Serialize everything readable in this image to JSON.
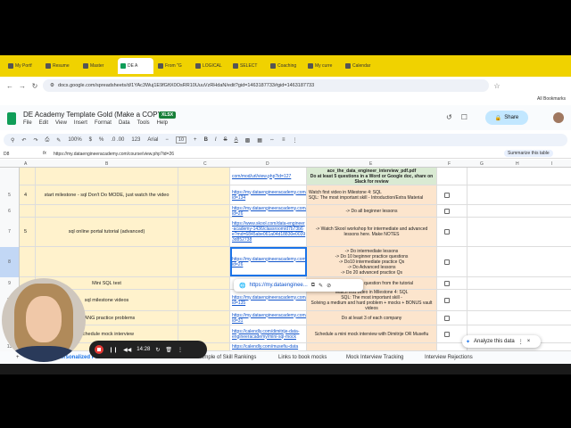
{
  "browser": {
    "tabs": [
      {
        "label": "My Portf"
      },
      {
        "label": "Resume"
      },
      {
        "label": "Master"
      },
      {
        "label": "DE A",
        "active": true
      },
      {
        "label": "From \"G"
      },
      {
        "label": "LOGICAL"
      },
      {
        "label": "SELECT"
      },
      {
        "label": "Coaching"
      },
      {
        "label": "My curre"
      },
      {
        "label": "Calendar"
      }
    ],
    "url": "docs.google.com/spreadsheets/d/1YAc3Wuj1E9fGftX0OsRR10UuuVzRHdaN/edit?gid=1463187733#gid=1463187733",
    "bookmarks_label": "All Bookmarks"
  },
  "doc": {
    "title": "DE Academy Template Gold (Make a COPY)",
    "badge": "XLSX",
    "menus": [
      "File",
      "Edit",
      "View",
      "Insert",
      "Format",
      "Data",
      "Tools",
      "Help"
    ],
    "share_label": "Share"
  },
  "toolbar": {
    "zoom": "100%",
    "currency": "$",
    "percent": "%",
    "decimals": ".0 .00",
    "numfmt": "123",
    "font": "Arial",
    "font_size": "10"
  },
  "formula_bar": {
    "cell": "D8",
    "fx": "fx",
    "content": "https://my.dataengineeracademy.com/course/view.php?id=26",
    "summarize_label": "Summarize this table"
  },
  "columns": [
    "A",
    "B",
    "C",
    "D",
    "E",
    "F",
    "G",
    "H",
    "I"
  ],
  "rows": [
    {
      "rownum": "",
      "num": "",
      "task": "",
      "link": "com/mod/url/view.php?id=127",
      "note": "ace_the_data_engineer_interview_pdf.pdf\nDo at least 5 questions in a Word or Google doc, share on Slack for review",
      "note_green": true
    },
    {
      "rownum": "5",
      "num": "4",
      "task": "start milestone - sql  Don't Do MODE, just watch the video",
      "link": "https://my.dataengineeracademy.com/mod/url/view.php?id=134",
      "note": "Watch first video in Milestone 4: SQL\nSQL: The most important skill - Introduction/Extra Material",
      "note_green": false
    },
    {
      "rownum": "6",
      "num": "",
      "task": "",
      "link": "https://my.dataengineeracademy.com/course/view.php?id=26",
      "note": "-> Do all beginner lessons",
      "note_green": false
    },
    {
      "rownum": "7",
      "num": "5",
      "task": "sql online portal tutorial (advanced)",
      "link": "https://www.skool.com/data-engineer-academy-1436/classroom/d7b73b6e?md=6845abe061a04d18830e00393d852738",
      "note": "-> Watch Skool workshop for intermediate and advanced lessons here. Make NOTES",
      "note_green": false
    },
    {
      "rownum": "8",
      "num": "",
      "task": "",
      "link": "https://my.dataengineeracademy.com/course/view.php?id=26",
      "note": "-> Do intermediate lessons\n-> Do 10 beginner practice questions\n-> Do10 intermediate practice Qs\n-> Do Advanced lessons\n-> Do 20 advanced practice Qs",
      "note_green": false
    },
    {
      "rownum": "9",
      "num": "",
      "task": "Mini SQL test",
      "link": "",
      "note": "mediate practice question from the tutorial",
      "note_green": false
    },
    {
      "rownum": "10",
      "num": "",
      "task": "sql milestone videos",
      "link": "https://my.dataengineeracademy.com/mod/url/view.php?id=135",
      "note": "Watch first video in Milestone 4: SQL\nSQL: The most important skill -\nSolving a medium and hard problem + mocks + BONUS vault videos",
      "note_green": false
    },
    {
      "rownum": "11",
      "num": "",
      "task": "FAANG practice problems",
      "link": "https://my.dataengineeracademy.com/course/view.php?id=31",
      "note": "Do at least 3 of each company",
      "note_green": false
    },
    {
      "rownum": "12",
      "num": "",
      "task": "Schedule mock interview",
      "link": "https://calendly.com/dimitrije-data-engineeracademy/mini-sql-mock",
      "note": "Schedule a mini mock interview with Dimitrije OR Musefiu",
      "note_green": false
    },
    {
      "rownum": "13",
      "num": "",
      "task": "",
      "link": "https://calendly.com/musefiu-data",
      "note": "",
      "note_green": false
    }
  ],
  "popup": {
    "url": "https://my.dataenginee..."
  },
  "explore_label": "Analyze this data",
  "sheet_tabs": [
    "Personalized Pl...",
    "Example of Skill Rankings",
    "Links to book mocks",
    "Mock Interview Tracking",
    "Interview Rejections"
  ],
  "recorder": {
    "time": "14:28"
  },
  "colors": {
    "tabbar": "#f0d200",
    "note_orange": "#fce5cd",
    "note_green": "#d9ead3",
    "task_yellow": "#fff2cc",
    "link_blue": "#1155cc",
    "share_blue": "#c2e7ff"
  }
}
